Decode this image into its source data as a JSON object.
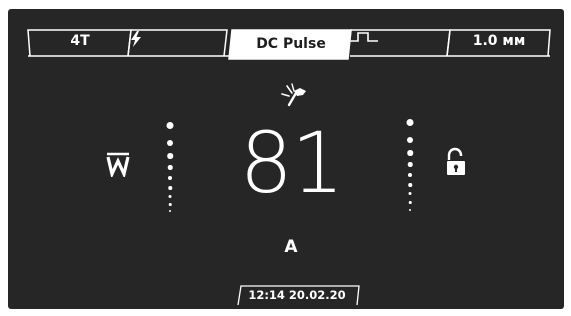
{
  "tabs": [
    {
      "label": "4T",
      "icon": null,
      "active": false
    },
    {
      "label": "",
      "icon": "lightning-icon",
      "active": false
    },
    {
      "label": "DC Pulse",
      "icon": null,
      "active": true
    },
    {
      "label": "",
      "icon": "pulse-wave-icon",
      "active": false
    },
    {
      "label": "1.0 мм",
      "icon": null,
      "active": false
    }
  ],
  "main": {
    "value": "81",
    "unit": "A",
    "top_icon": "tig-torch-icon",
    "left_icon": "tungsten-electrode-icon",
    "right_icon": "unlock-icon"
  },
  "footer": {
    "datetime": "12:14  20.02.20"
  },
  "colors": {
    "background": "#262626",
    "foreground": "#ffffff",
    "active_tab": "#ffffff",
    "active_text": "#1e1e1e"
  }
}
